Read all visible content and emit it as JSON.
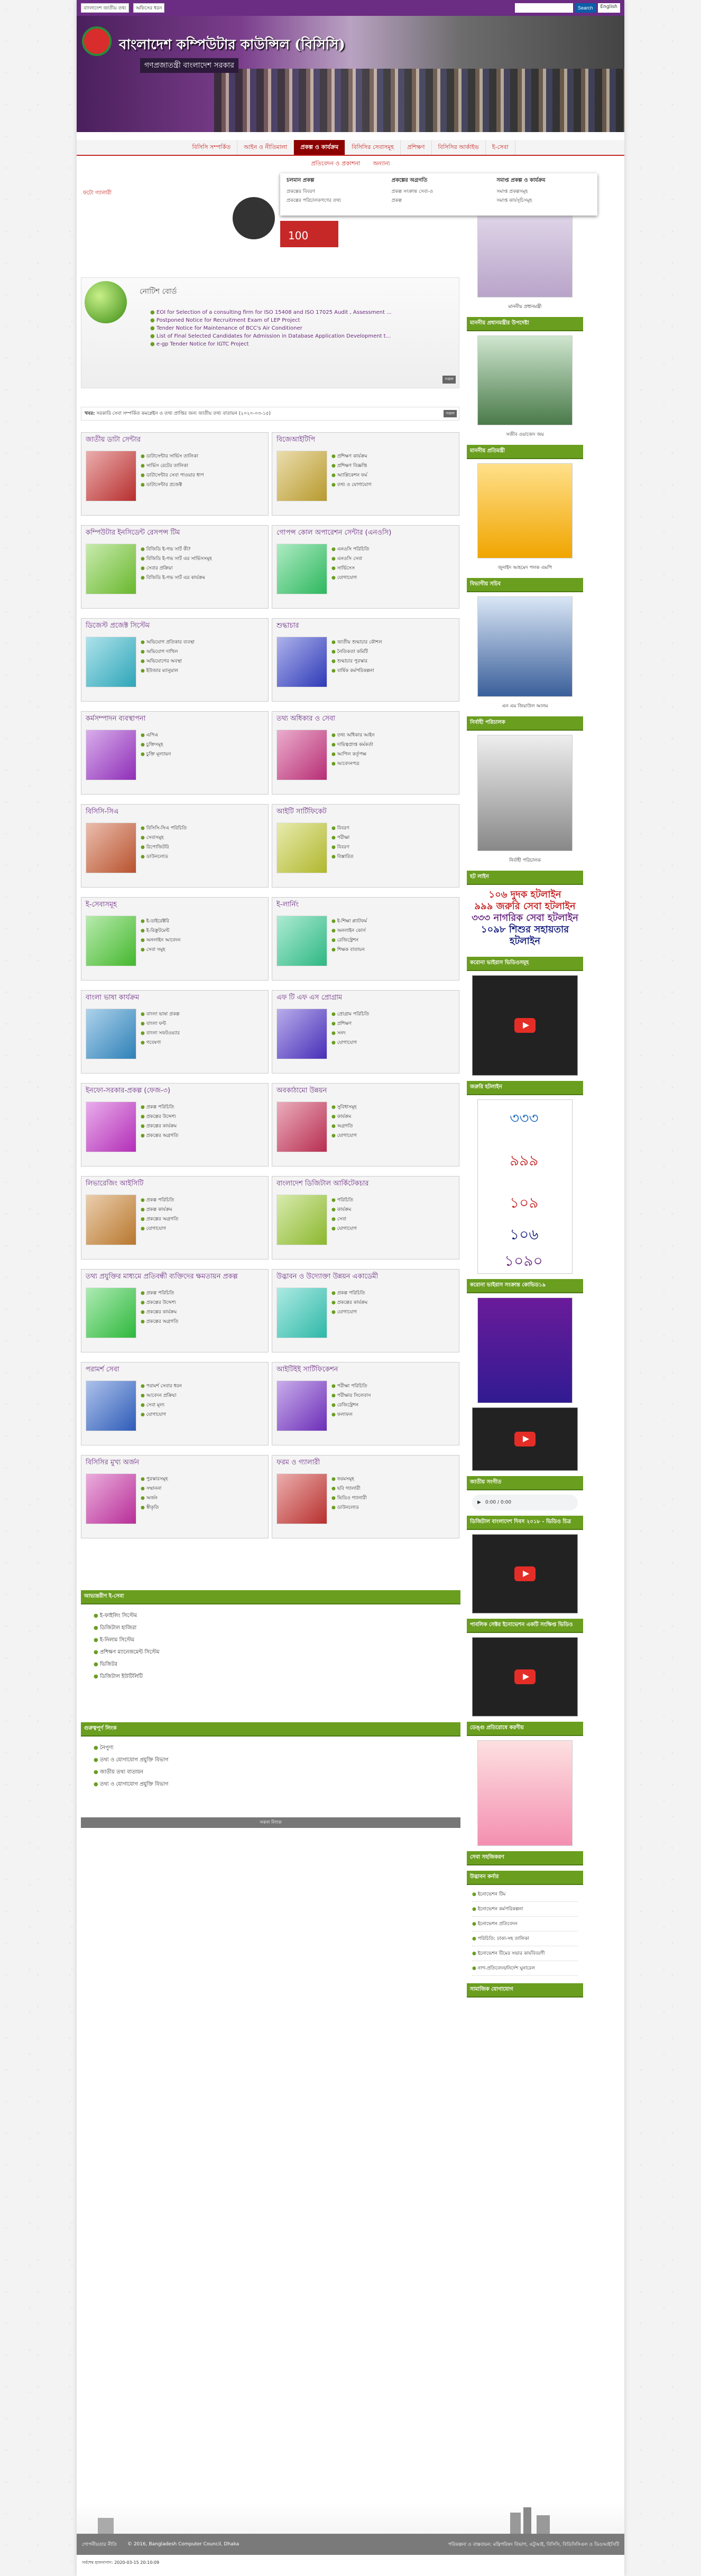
{
  "topbar": {
    "office_select": "বাংলাদেশ জাতীয় তথ্য",
    "type_select": "অফিসের ধরন",
    "search_placeholder": "",
    "search_button": "Search",
    "lang": "English"
  },
  "header": {
    "org_name": "বাংলাদেশ কম্পিউটার কাউন্সিল (বিসিসি)",
    "govt": "গণপ্রজাতন্ত্রী বাংলাদেশ সরকার"
  },
  "nav": {
    "items": [
      "বিসিসি সম্পর্কিত",
      "আইন ও নীতিমালা",
      "প্রকল্প ও কার্যক্রম",
      "বিসিসির সেবাসমূহ",
      "প্রশিক্ষণ",
      "বিসিসির আর্কাইভ",
      "ই-সেবা"
    ],
    "items2": [
      "প্রতিবেদন ও প্রকাশনা",
      "অন্যান্য"
    ]
  },
  "dropdown": {
    "col1_title": "চলমান প্রকল্প",
    "col1": [
      "প্রকল্পের বিবরণ",
      "প্রকল্পের পরিচালকগণের তথ্য"
    ],
    "col2_title": "প্রকল্পের অগ্রগতি",
    "col2": [
      "প্রকল্প সংক্রান্ত সেবা-ও",
      "প্রকল্প"
    ],
    "col3_title": "সমাপ্ত প্রকল্প ও কার্যক্রম",
    "col3": [
      "সমাপ্ত প্রকল্পসমূহ",
      "সমাপ্ত কার্যসূচিসমূহ"
    ]
  },
  "leftlink": "ফটো গ্যালারী",
  "notice": {
    "title": "নোটিশ বোর্ড",
    "items": [
      "EOI for Selection of a consulting firm for ISO 15408 and ISO 17025 Audit , Assessment ...",
      "Postponed Notice for Recruitment Exam of LEP Project",
      "Tender Notice for Maintenance of BCC's Air Conditioner",
      "List of Final Selected Candidates for Admission in Database Application Development t...",
      "e-gp Tender Notice for IGTC Project"
    ],
    "all": "সকল"
  },
  "ticker": {
    "label": "খবর:",
    "text": "সরকারি সেবা সম্পর্কিত কমপ্লেইন ও তথ্য প্রাপ্তির জন্য জাতীয় তথ্য বাতায়ন (২০২০-০৩-১৫)",
    "all": "সকল"
  },
  "cards": [
    {
      "title": "জাতীয় ডাটা সেন্টার",
      "icon": "server-icon",
      "items": [
        "ডাটাসেন্টার সার্ভিস তালিকা",
        "সার্ভিস রেটের তালিকা",
        "ডাটাসেন্টার সেবা পাওয়ার ধাপ",
        "ডাটাসেন্টার প্রজেক্ট"
      ]
    },
    {
      "title": "বিজেআইটিপি",
      "icon": "classroom-icon",
      "items": [
        "প্রশিক্ষণ কার্যক্রম",
        "প্রশিক্ষণ বিজ্ঞপ্তি",
        "অ্যাপ্লিকেশন ফর্ম",
        "তথ্য ও যোগাযোগ"
      ]
    },
    {
      "title": "কম্পিউটার ইনসিডেন্ট রেসপন্স টিম",
      "icon": "eye-icon",
      "items": [
        "বিজিডি ই-গভ সার্ট কী?",
        "বিজিডি ই-গভ সার্ট এর সার্ভিসসমূহ",
        "সেবার প্রক্রিয়া",
        "বিজিডি ই-গভ সার্ট এর কার্যক্রম"
      ]
    },
    {
      "title": "গোপন্স কোল অপারেশন সেন্টার (এনওসি)",
      "icon": "noc-icon",
      "items": [
        "এনওসি পরিচিতি",
        "এনওসি সেবা",
        "সার্ভিসেস",
        "যোগাযোগ"
      ]
    },
    {
      "title": "ডিজেস্ট প্রজেক্ট সিস্টেম",
      "icon": "digital-icon",
      "items": [
        "অভিযোগ প্রতিকার ব্যবস্থা",
        "অভিযোগ দাখিল",
        "অভিযোগের অবস্থা",
        "ইউজার ম্যানুয়াল"
      ]
    },
    {
      "title": "শুদ্ধাচার",
      "icon": "check-icon",
      "items": [
        "জাতীয় শুদ্ধাচার কৌশল",
        "নৈতিকতা কমিটি",
        "শুদ্ধাচার পুরস্কার",
        "বার্ষিক কর্মপরিকল্পনা"
      ]
    },
    {
      "title": "কর্মসম্পাদন ব্যবস্থাপনা",
      "icon": "growth-icon",
      "items": [
        "এপিএ",
        "চুক্তিসমূহ",
        "চুক্তি মূল্যায়ন"
      ]
    },
    {
      "title": "তথ্য অধিকার ও সেবা",
      "icon": "people-icon",
      "items": [
        "তথ্য অধিকার আইন",
        "দায়িত্বপ্রাপ্ত কর্মকর্তা",
        "আপিল কর্তৃপক্ষ",
        "আবেদনপত্র"
      ]
    },
    {
      "title": "বিসিসি-সিএ",
      "icon": "certificate-icon",
      "items": [
        "বিসিসি-সিএ পরিচিতি",
        "সেবাসমূহ",
        "রিপোজিটরি",
        "ডাউনলোড"
      ]
    },
    {
      "title": "আইটি সার্টিফিকেট",
      "icon": "it-icon",
      "items": [
        "বিবরণ",
        "পরীক্ষা",
        "বিবরণ",
        "বিস্তারিত"
      ]
    },
    {
      "title": "ই-সেবাসমূহ",
      "icon": "eservice-icon",
      "items": [
        "ই-ডাইরেক্টরি",
        "ই-রিক্রুটমেন্ট",
        "অনলাইন আবেদন",
        "সেবা সমূহ"
      ]
    },
    {
      "title": "ই-লার্নিং",
      "icon": "elearning-icon",
      "items": [
        "ই-শিক্ষা প্ল্যাটফর্ম",
        "অনলাইন কোর্স",
        "রেজিস্ট্রেশন",
        "শিক্ষক বাতায়ন"
      ]
    },
    {
      "title": "বাংলা ভাষা কার্যক্রম",
      "icon": "bangla-icon",
      "items": [
        "বাংলা ভাষা প্রকল্প",
        "বাংলা ফন্ট",
        "বাংলা সফটওয়্যার",
        "গবেষণা"
      ]
    },
    {
      "title": "এফ টি এফ এস প্রোগ্রাম",
      "icon": "internet-icon",
      "items": [
        "প্রোগ্রাম পরিচিতি",
        "প্রশিক্ষণ",
        "সনদ",
        "যোগাযোগ"
      ]
    },
    {
      "title": "ইনফো-সরকার-প্রকল্প (ফেজ-৩)",
      "icon": "fiber-icon",
      "items": [
        "প্রকল্প পরিচিতি",
        "প্রকল্পের উদ্দেশ্য",
        "প্রকল্পের কার্যক্রম",
        "প্রকল্পের অগ্রগতি"
      ]
    },
    {
      "title": "অবকাঠামো উন্নয়ন",
      "icon": "infra-icon",
      "items": [
        "সুবিধাসমূহ",
        "কার্যক্রম",
        "অগ্রগতি",
        "যোগাযোগ"
      ]
    },
    {
      "title": "লিভারেজিং আইসিটি",
      "icon": "ict-icon",
      "items": [
        "প্রকল্প পরিচিতি",
        "প্রকল্প কার্যক্রম",
        "প্রকল্পের অগ্রগতি",
        "যোগাযোগ"
      ]
    },
    {
      "title": "বাংলাদেশ ডিজিটাল আর্কিটেকচার",
      "icon": "bnea-icon",
      "items": [
        "পরিচিতি",
        "কার্যক্রম",
        "সেবা",
        "যোগাযোগ"
      ]
    },
    {
      "title": "তথ্য প্রযুক্তির মাধ্যমে প্রতিবন্ধী ব্যক্তিদের ক্ষমতায়ন প্রকল্প",
      "icon": "disability-icon",
      "items": [
        "প্রকল্প পরিচিতি",
        "প্রকল্পের উদ্দেশ্য",
        "প্রকল্পের কার্যক্রম",
        "প্রকল্পের অগ্রগতি"
      ]
    },
    {
      "title": "উদ্ভাবন ও উদ্যোক্তা উন্নয়ন একাডেমী",
      "icon": "startup-icon",
      "items": [
        "প্রকল্প পরিচিতি",
        "প্রকল্পের কার্যক্রম",
        "যোগাযোগ"
      ]
    },
    {
      "title": "পরামর্শ সেবা",
      "icon": "consult-icon",
      "items": [
        "পরামর্শ সেবার ধরন",
        "আবেদন প্রক্রিয়া",
        "সেবা মূল্য",
        "যোগাযোগ"
      ]
    },
    {
      "title": "আইটিইই সার্টিফিকেশন",
      "icon": "itee-icon",
      "items": [
        "পরীক্ষা পরিচিতি",
        "পরীক্ষার সিলেবাস",
        "রেজিস্ট্রেশন",
        "ফলাফল"
      ]
    },
    {
      "title": "বিসিসির মুখ্য অর্জন",
      "icon": "awards-icon",
      "items": [
        "পুরস্কারসমূহ",
        "সম্মাননা",
        "অর্জন",
        "স্বীকৃতি"
      ]
    },
    {
      "title": "ফরম ও গ্যালারী",
      "icon": "forms-icon",
      "items": [
        "ফরমসমূহ",
        "ছবি গ্যালারী",
        "ভিডিও গ্যালারী",
        "ডাউনলোড"
      ]
    }
  ],
  "eservice": {
    "title": "আভ্যন্তরীণ ই-সেবা",
    "items": [
      "ই-ফাইলিং সিস্টেম",
      "ডিজিটাল হাজিরা",
      "ই-নিলাম সিস্টেম",
      "প্রশিক্ষণ ম্যানেজমেন্ট সিস্টেম",
      "ভিজিটর",
      "ডিজিটাল ইউটিলিটি"
    ]
  },
  "important": {
    "title": "গুরুত্বপূর্ণ লিংক",
    "items": [
      "নৈপুণ্য",
      "তথ্য ও যোগাযোগ প্রযুক্তি বিভাগ",
      "জাতীয় তথ্য বাতায়ন",
      "তথ্য ও যোগাযোগ প্রযুক্তি বিভাগ"
    ],
    "more": "সকল লিংক"
  },
  "right": {
    "pm_caption": "মাননীয় প্রধানমন্ত্রী",
    "adv_title": "মাননীয় প্রধানমন্ত্রীর উপদেষ্টা",
    "adv_caption": "সজীব ওয়াজেদ জয়",
    "minister_title": "মাননীয় প্রতিমন্ত্রী",
    "minister_caption": "জুনাইদ আহমেদ পলক এমপি",
    "secretary_title": "বিভাগীয় সচিব",
    "secretary_caption": "এন এম জিয়াউল আলম",
    "ed_title": "নির্বাহী পরিচালক",
    "ed_caption": "নির্বাহী পরিচালক",
    "hotline_title": "হট লাইন",
    "hotline": [
      "১০৬ দুদক হটলাইন",
      "৯৯৯ জরুরি সেবা হটলাইন",
      "৩৩৩ নাগরিক সেবা হটলাইন",
      "১০৯৮ শিশুর সহায়তার হটলাইন"
    ],
    "video_title": "করোনা ভাইরাস ভিডিওসমূহ",
    "services_title": "জরুরি হটলাইন",
    "corona_title": "করোনা ভাইরাস সংক্রান্ত কোভিড১৯",
    "anthem_title": "জাতীয় সংগীত",
    "audio_time": "0:00 / 0:00",
    "digital_title": "ডিজিটাল বাংলাদেশ দিবস ২০১৮ - ভিডিও চিত্র",
    "public_title": "পাবলিক সেক্টর ইনোভেশন একটি সংক্ষিপ্ত ভিডিও",
    "dengue_title": "ডেঙ্গু প্রতিরোধে করণীয়",
    "social_title": "সেবা সহজিকরণ",
    "innov_title": "উদ্ভাবন কর্নার",
    "innov": [
      "ইনোভেশন টিম",
      "ইনোভেশন কর্মপরিকল্পনা",
      "ইনোভেশন প্রতিবেদন",
      "পরিচিতি: ঢাকা-সহ তালিকা",
      "ইনোভেশন টিমের সভার কার্যবিবরণী",
      "নাগ-প্রতিবেদন/নির্দেশ ঘুনারেল"
    ],
    "contact_title": "সামাজিক যোগাযোগ"
  },
  "footer": {
    "privacy": "গোপনীয়তার নীতি",
    "copyright": "© 2016, Bangladesh Computer Council, Dhaka",
    "links": "পরিকল্পনা ও বাস্তবায়ন: মন্ত্রিপরিষদ বিভাগ, এটুআই, বিসিসি, বিডিসিসিএল ও ডিওআইসিটি",
    "updated": "সর্বশেষ হালনাগাদ: 2020-03-15 20:10:09"
  }
}
